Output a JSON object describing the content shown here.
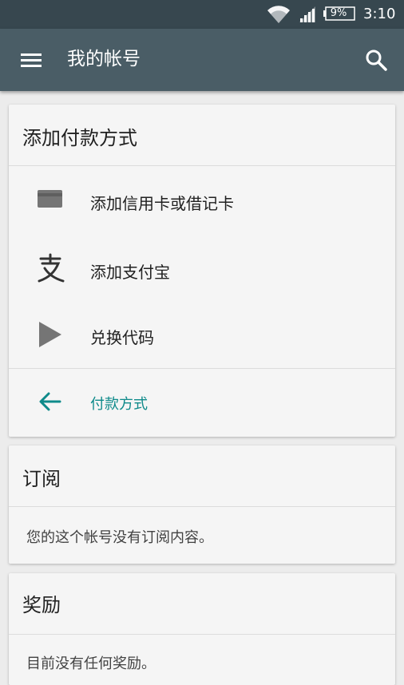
{
  "status_bar": {
    "battery": "9%",
    "time": "3:10"
  },
  "app_bar": {
    "title": "我的帐号",
    "menu_icon": "menu-icon",
    "search_icon": "search-icon"
  },
  "payment_card": {
    "title": "添加付款方式",
    "options": [
      {
        "label": "添加信用卡或借记卡",
        "icon": "credit-card-icon"
      },
      {
        "label": "添加支付宝",
        "icon": "alipay-icon"
      },
      {
        "label": "兑换代码",
        "icon": "play-icon"
      }
    ],
    "back_link": {
      "label": "付款方式",
      "icon": "back-arrow-icon"
    }
  },
  "subscriptions_card": {
    "title": "订阅",
    "body": "您的这个帐号没有订阅内容。"
  },
  "rewards_card": {
    "title": "奖励",
    "body": "目前没有任何奖励。"
  },
  "colors": {
    "status_bar": "#37474f",
    "app_bar": "#4a5d66",
    "accent": "#0e8a8a",
    "background": "#ececec",
    "card": "#f5f5f5"
  }
}
